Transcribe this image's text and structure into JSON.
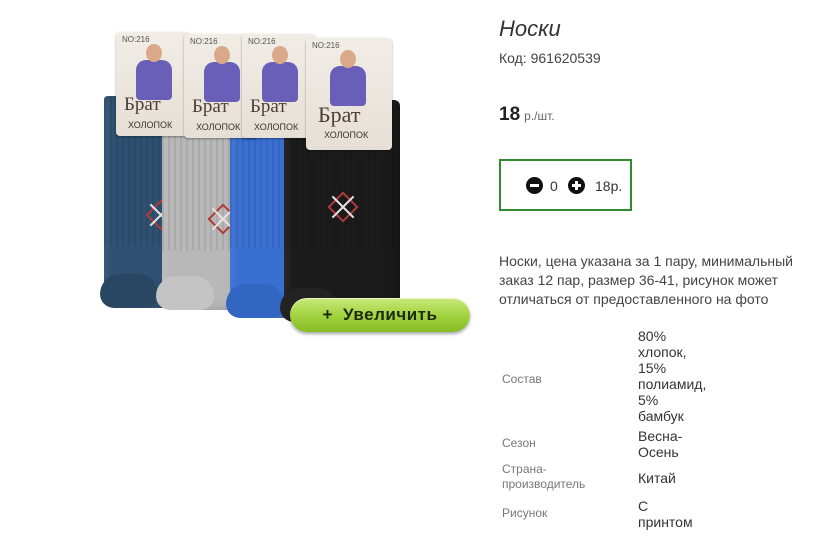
{
  "product": {
    "title": "Носки",
    "code": "Код: 961620539",
    "price": "18",
    "price_unit": "р./шт.",
    "zoom_button": "Увеличить",
    "zoom_icon": "+",
    "quantity": "0",
    "total": "18р.",
    "description": "Носки, цена указана за 1 пару, минимальный заказ 12 пар, размер 36-41, рисунок может отличаться от предоставленного на фото"
  },
  "photo": {
    "tag_number": "NO:216",
    "brand": "Брат",
    "brand_sub": "ХОЛОПОК",
    "sock_colors": [
      "#2f5070",
      "#b8b8b8",
      "#3a6fd2",
      "#1b1b1b"
    ]
  },
  "properties": [
    {
      "name": "Состав",
      "value": "80% хлопок, 15% полиамид, 5% бамбук"
    },
    {
      "name": "Сезон",
      "value": "Весна-Осень"
    },
    {
      "name": "Страна-производитель",
      "value": "Китай"
    },
    {
      "name": "Рисунок",
      "value": "С принтом"
    }
  ],
  "colors": {
    "qty_border": "#2f8b2f",
    "zoom_button": "#9fd13c"
  }
}
